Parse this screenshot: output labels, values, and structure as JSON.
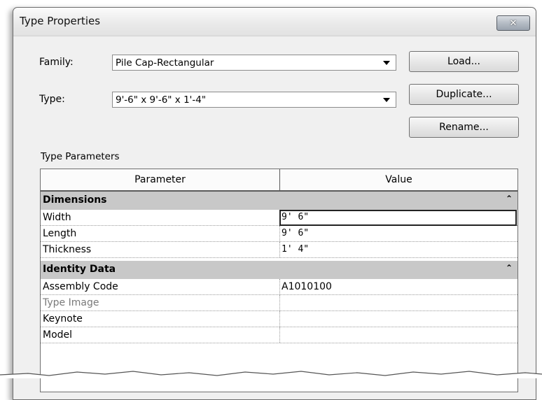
{
  "dialog": {
    "title": "Type Properties",
    "close_glyph": "✕"
  },
  "family": {
    "label": "Family:",
    "value": "Pile Cap-Rectangular"
  },
  "type": {
    "label": "Type:",
    "value": "9'-6\" x 9'-6\" x 1'-4\""
  },
  "buttons": {
    "load": "Load...",
    "duplicate": "Duplicate...",
    "rename": "Rename..."
  },
  "parameters": {
    "section_label": "Type Parameters",
    "columns": [
      "Parameter",
      "Value"
    ],
    "groups": [
      {
        "name": "Dimensions",
        "rows": [
          {
            "name": "Width",
            "value": "9'  6\""
          },
          {
            "name": "Length",
            "value": "9'  6\""
          },
          {
            "name": "Thickness",
            "value": "1'  4\""
          }
        ]
      },
      {
        "name": "Identity Data",
        "rows": [
          {
            "name": "Assembly Code",
            "value": "A1010100"
          },
          {
            "name": "Type Image",
            "value": ""
          },
          {
            "name": "Keynote",
            "value": ""
          },
          {
            "name": "Model",
            "value": ""
          }
        ]
      }
    ]
  },
  "colors": {
    "group_header": "#c8c8c8",
    "dialog_bg": "#f0f0f0"
  }
}
